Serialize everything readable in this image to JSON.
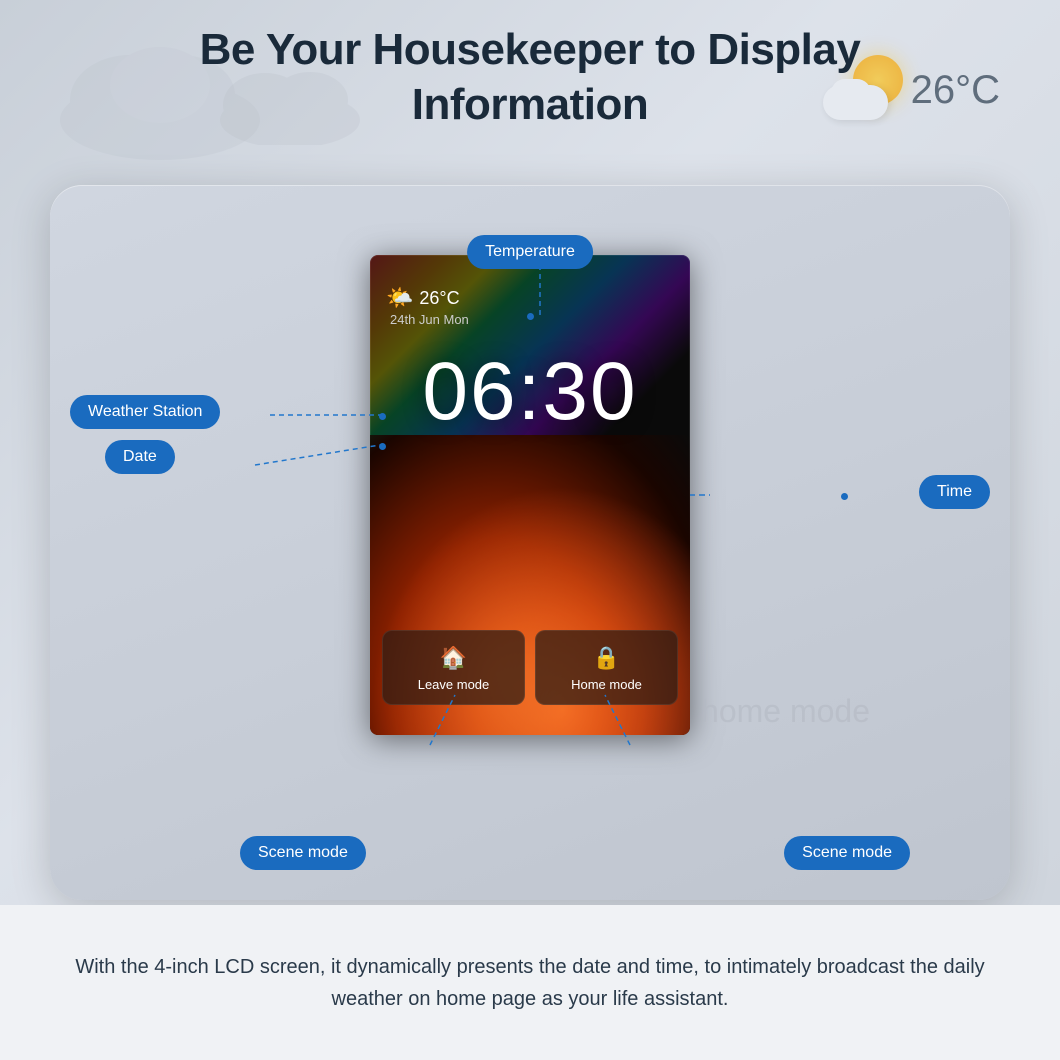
{
  "page": {
    "heading_line1": "Be Your Housekeeper to Display",
    "heading_line2": "Information",
    "description": "With the 4-inch LCD screen, it dynamically presents the date and time, to intimately broadcast the daily weather on home page as your life assistant."
  },
  "top_weather": {
    "temperature": "26°C"
  },
  "screen": {
    "temperature": "26°C",
    "date": "24th Jun  Mon",
    "time": "06:30",
    "modes": [
      {
        "label": "Leave mode",
        "icon": "🏠"
      },
      {
        "label": "Home mode",
        "icon": "🔒"
      }
    ]
  },
  "annotations": {
    "temperature": "Temperature",
    "weather_station": "Weather Station",
    "date": "Date",
    "time": "Time",
    "scene_mode_1": "Scene mode",
    "scene_mode_2": "Scene mode"
  },
  "watermark": "home mode"
}
